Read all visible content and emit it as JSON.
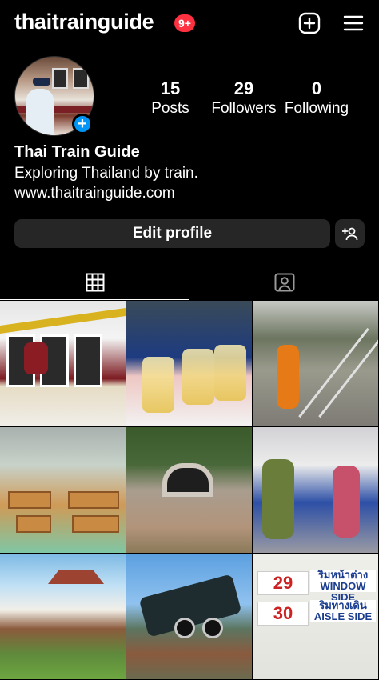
{
  "header": {
    "username": "thaitrainguide",
    "notification_count": "9+",
    "create_icon": "plus-square-icon",
    "menu_icon": "hamburger-menu-icon"
  },
  "profile": {
    "stats": {
      "posts": {
        "value": "15",
        "label": "Posts"
      },
      "followers": {
        "value": "29",
        "label": "Followers"
      },
      "following": {
        "value": "0",
        "label": "Following"
      }
    },
    "name": "Thai Train Guide",
    "bio": "Exploring Thailand by train.",
    "website": "www.thaitrainguide.com"
  },
  "actions": {
    "edit_profile_label": "Edit profile",
    "discover_people_icon": "add-person-icon"
  },
  "tabs": [
    {
      "icon": "grid-icon",
      "active": true
    },
    {
      "icon": "tagged-icon",
      "active": false
    }
  ],
  "grid": {
    "seat_sign": {
      "row1_number": "29",
      "row1_thai": "ริมหน้าต่าง",
      "row1_english": "WINDOW SIDE",
      "row2_number": "30",
      "row2_thai": "ริมทางเดิน",
      "row2_english": "AISLE SIDE"
    }
  },
  "colors": {
    "background": "#000000",
    "badge": "#ff3040",
    "accent": "#0095f6",
    "button": "#262626"
  }
}
